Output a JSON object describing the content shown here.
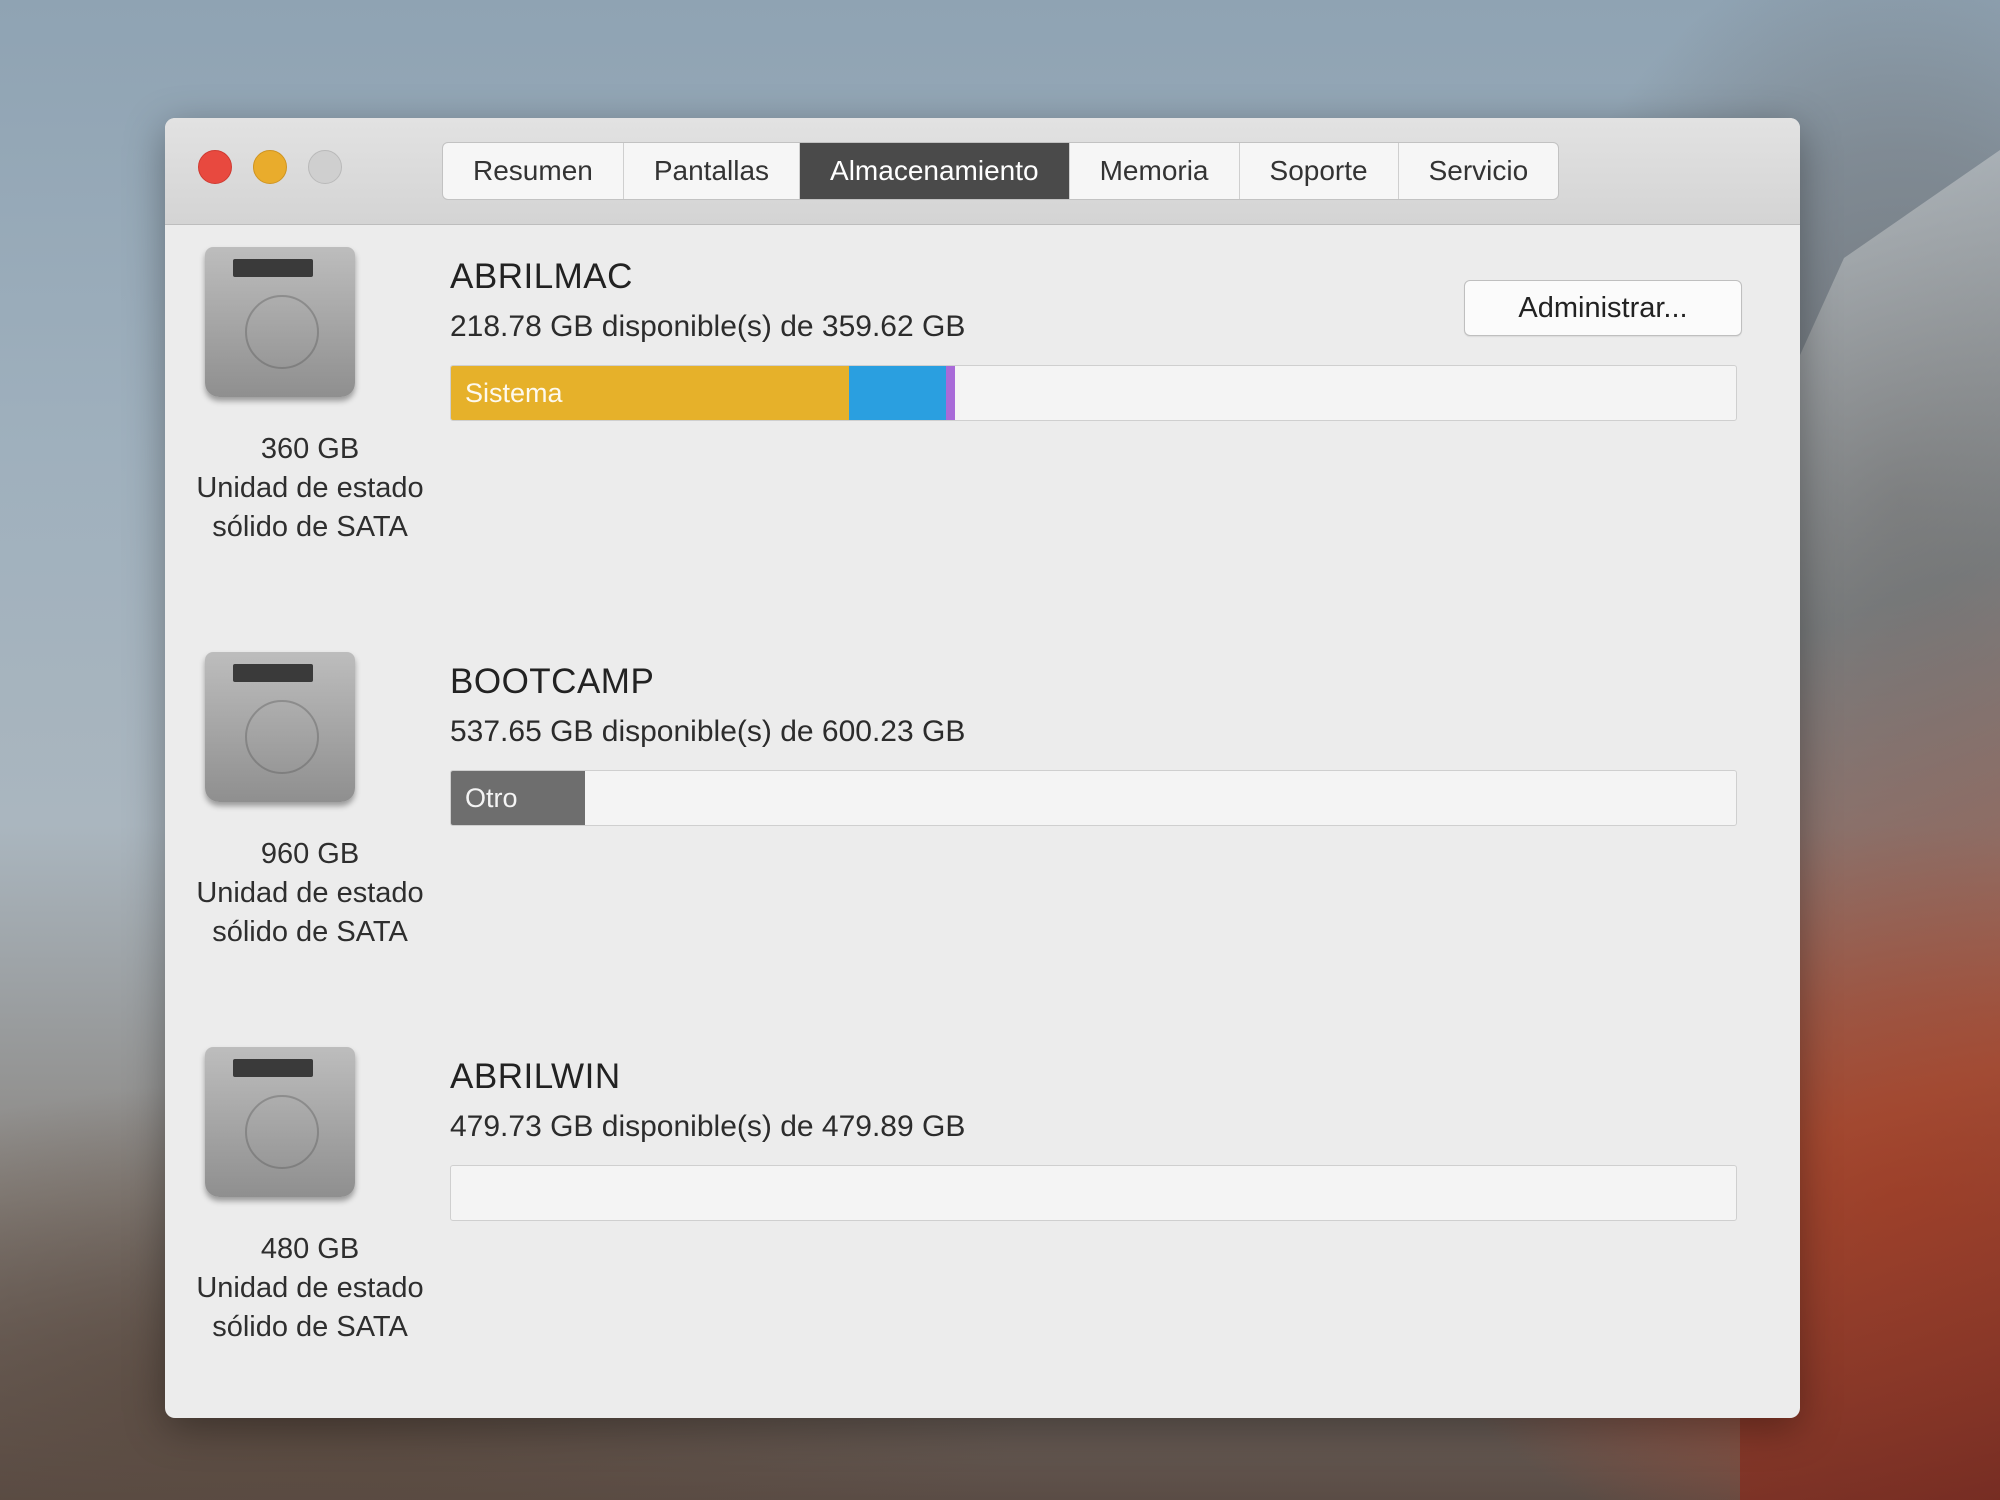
{
  "window": {
    "tabs": [
      {
        "label": "Resumen",
        "active": false
      },
      {
        "label": "Pantallas",
        "active": false
      },
      {
        "label": "Almacenamiento",
        "active": true
      },
      {
        "label": "Memoria",
        "active": false
      },
      {
        "label": "Soporte",
        "active": false
      },
      {
        "label": "Servicio",
        "active": false
      }
    ]
  },
  "colors": {
    "system": "#e6b12a",
    "apps": "#2a9fe0",
    "misc": "#a86ad8",
    "other": "#6e6e6e",
    "bar_empty": "#f4f4f4",
    "active_tab": "#4a4a4a"
  },
  "manage_button_label": "Administrar...",
  "disks": [
    {
      "name": "ABRILMAC",
      "available": "218.78 GB disponible(s) de 359.62 GB",
      "capacity": "360 GB",
      "type_line1": "Unidad de estado",
      "type_line2": "sólido de SATA",
      "icon": "hard-drive-icon",
      "segments": [
        {
          "label": "Sistema",
          "fraction": 0.31,
          "color": "#e6b12a"
        },
        {
          "label": "",
          "fraction": 0.075,
          "color": "#2a9fe0"
        },
        {
          "label": "",
          "fraction": 0.007,
          "color": "#a86ad8"
        }
      ]
    },
    {
      "name": "BOOTCAMP",
      "available": "537.65 GB disponible(s) de 600.23 GB",
      "capacity": "960 GB",
      "type_line1": "Unidad de estado",
      "type_line2": "sólido de SATA",
      "icon": "hard-drive-icon",
      "segments": [
        {
          "label": "Otro",
          "fraction": 0.104,
          "color": "#6e6e6e"
        }
      ]
    },
    {
      "name": "ABRILWIN",
      "available": "479.73 GB disponible(s) de 479.89 GB",
      "capacity": "480 GB",
      "type_line1": "Unidad de estado",
      "type_line2": "sólido de SATA",
      "icon": "hard-drive-icon",
      "segments": []
    }
  ]
}
